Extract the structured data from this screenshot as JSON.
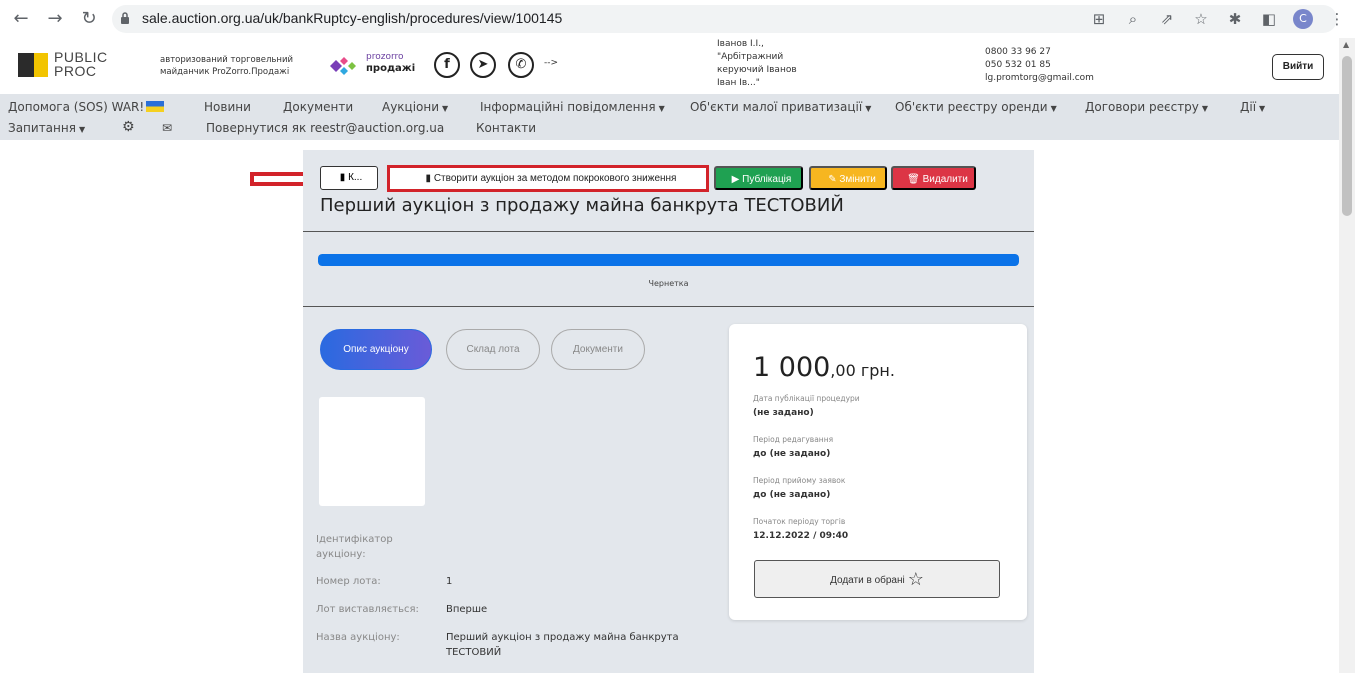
{
  "browser": {
    "url": "sale.auction.org.ua/uk/bankRuptcy-english/procedures/view/100145",
    "profile_initial": "C"
  },
  "header": {
    "logo_line1": "PUBLIC",
    "logo_line2": "PROC",
    "auth_line1": "авторизований торговельний",
    "auth_line2": "майданчик ProZorro.Продажі",
    "prozorro_line1": "prozorro",
    "prozorro_line2": "продажі",
    "arrow": "-->",
    "user_line1": "Іванов І.І.,",
    "user_line2": "\"Арбітражний",
    "user_line3": "керуючий Іванов",
    "user_line4": "Іван Ів...\"",
    "phone1": "0800 33 96 27",
    "phone2": "050 532 01 85",
    "email": "lg.promtorg@gmail.com",
    "logout_label": "Вийти"
  },
  "nav": {
    "help": "Допомога (SOS) WAR!",
    "news": "Новини",
    "documents": "Документи",
    "auctions": "Аукціони",
    "info": "Інформаційні повідомлення",
    "privatization": "Об'єкти малої приватизації",
    "rent": "Об'єкти реєстру оренди",
    "contracts": "Договори реєстру",
    "actions": "Дії",
    "requests": "Запитання",
    "return": "Повернутися як reestr@auction.org.ua",
    "contacts": "Контакти"
  },
  "actions": {
    "copy_label": "К...",
    "create_label": "Створити аукціон за методом покрокового зниження",
    "publish_label": "Публікація",
    "edit_label": "Змінити",
    "delete_label": "Видалити"
  },
  "page": {
    "title": "Перший аукціон з продажу майна банкрута ТЕСТОВИЙ",
    "status": "Чернетка",
    "progress_fraction": 1.0
  },
  "tabs": {
    "description": "Опис аукціону",
    "lot": "Склад лота",
    "documents": "Документи"
  },
  "fields": {
    "id_label": "Ідентифікатор аукціону:",
    "lot_number_label": "Номер лота:",
    "lot_number_value": "1",
    "lot_exposed_label": "Лот виставляється:",
    "lot_exposed_value": "Вперше",
    "name_label": "Назва аукціону:",
    "name_value": "Перший аукціон з продажу майна банкрута ТЕСТОВИЙ"
  },
  "card": {
    "price_main": "1 000",
    "price_suffix": ",00 грн.",
    "pub_date_label": "Дата публікації процедури",
    "pub_date_value": "(не задано)",
    "edit_period_label": "Період редагування",
    "edit_period_value": "до (не задано)",
    "bids_period_label": "Період прийому заявок",
    "bids_period_value": "до (не задано)",
    "trade_start_label": "Початок періоду торгів",
    "trade_start_value": "12.12.2022 / 09:40",
    "favorite_label": "Додати в обрані"
  },
  "colors": {
    "annotation": "#d2232a",
    "progress": "#0b73e8",
    "publish": "#1fa152",
    "edit": "#f7b620",
    "delete": "#dc3545",
    "nav_bg": "#e0e4e9",
    "panel_bg": "#e3e7ec"
  }
}
